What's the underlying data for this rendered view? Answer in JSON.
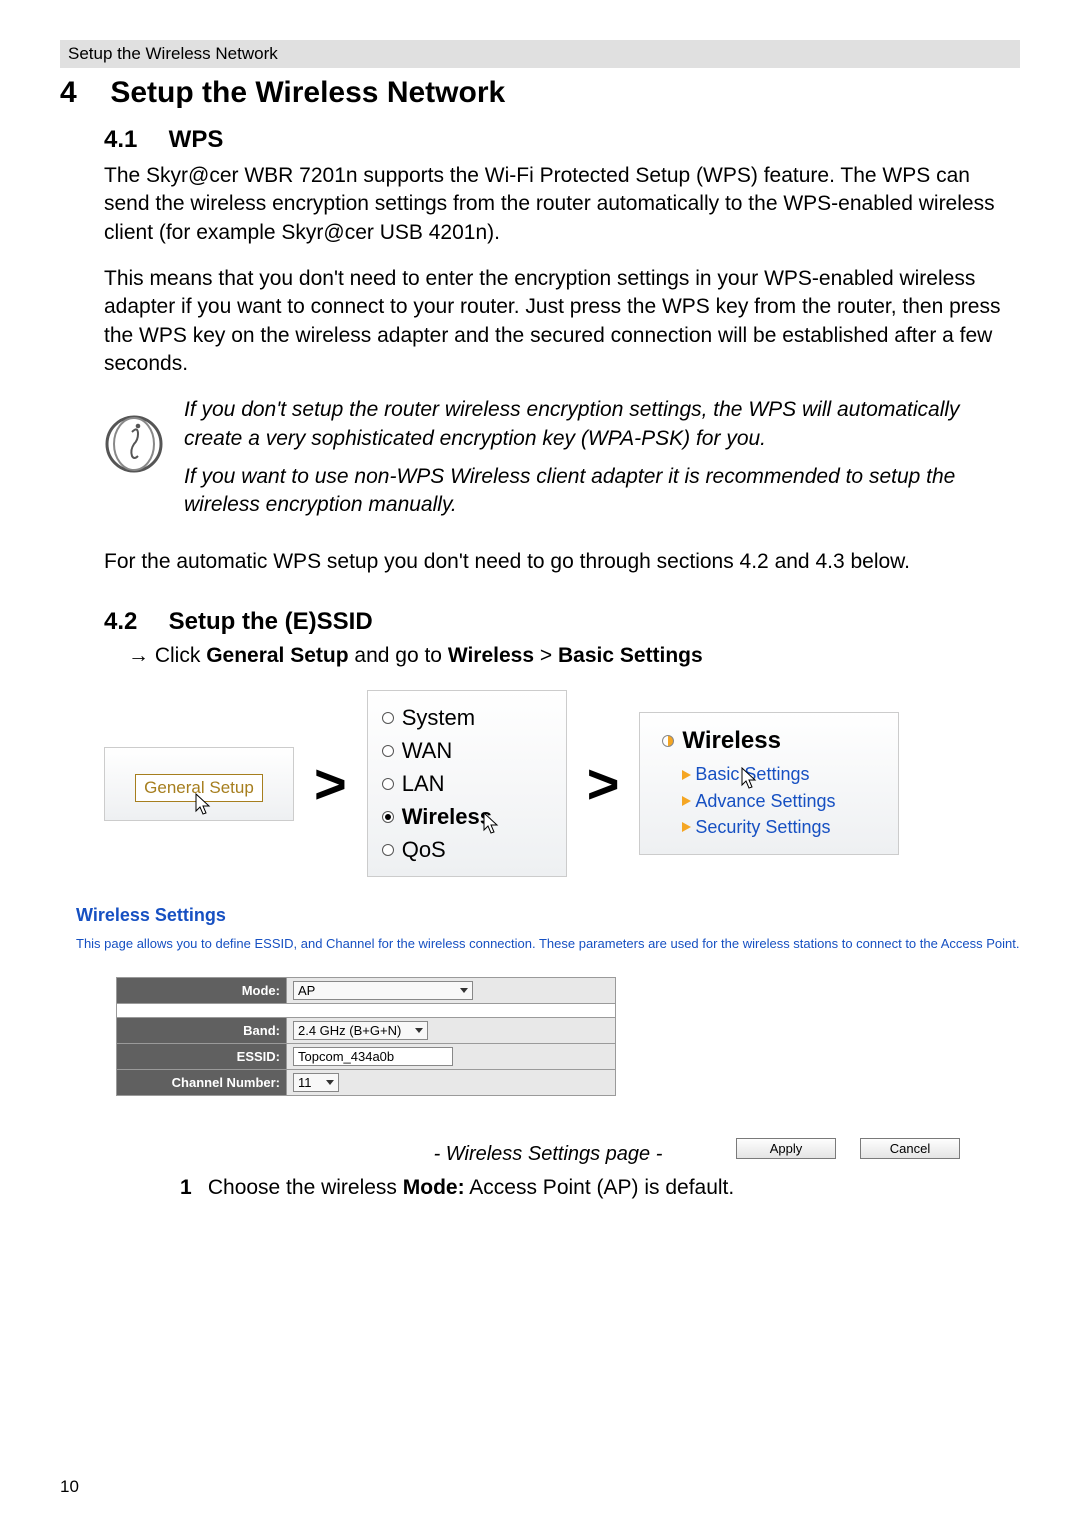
{
  "header": {
    "running_title": "Setup the Wireless Network"
  },
  "section4": {
    "num": "4",
    "title": "Setup the Wireless Network",
    "s41": {
      "num": "4.1",
      "title": "WPS",
      "p1": "The Skyr@cer WBR 7201n supports the Wi-Fi Protected Setup (WPS) feature. The WPS can send the wireless encryption settings from the router automatically to the WPS-enabled wireless client (for example Skyr@cer USB 4201n).",
      "p2": "This means that you don't need to enter the encryption settings in your WPS-enabled wireless adapter if you want to connect to your router. Just press the WPS key from the router, then press the WPS key on the wireless adapter and the secured connection will be established after a few seconds.",
      "note1": "If you don't setup the router wireless encryption settings, the WPS will automatically create a very sophisticated encryption key (WPA-PSK) for you.",
      "note2": "If you want to use non-WPS Wireless client adapter it is recommended to setup the wireless encryption manually.",
      "p3": "For the automatic WPS setup you don't need to go through sections 4.2 and 4.3 below."
    },
    "s42": {
      "num": "4.2",
      "title": "Setup the (E)SSID",
      "instruction_prefix": "Click ",
      "instruction_b1": "General Setup",
      "instruction_mid": " and go to ",
      "instruction_b2": "Wireless",
      "instruction_sep": " > ",
      "instruction_b3": "Basic Settings",
      "nav": {
        "general_setup": "General Setup",
        "menu": {
          "system": "System",
          "wan": "WAN",
          "lan": "LAN",
          "wireless": "Wireless",
          "qos": "QoS"
        },
        "sub": {
          "title": "Wireless",
          "basic": "Basic Settings",
          "advanced": "Advance Settings",
          "security": "Security Settings"
        }
      },
      "wireless_settings": {
        "heading": "Wireless Settings",
        "description": "This page allows you to define ESSID, and Channel for the wireless connection. These parameters are used for the wireless stations to connect to the Access Point.",
        "rows": {
          "mode_label": "Mode:",
          "mode_value": "AP",
          "band_label": "Band:",
          "band_value": "2.4 GHz (B+G+N)",
          "essid_label": "ESSID:",
          "essid_value": "Topcom_434a0b",
          "channel_label": "Channel Number:",
          "channel_value": "11"
        },
        "buttons": {
          "apply": "Apply",
          "cancel": "Cancel"
        },
        "caption": "- Wireless Settings page -"
      },
      "step1": {
        "n": "1",
        "text_a": "Choose the wireless ",
        "text_b": "Mode:",
        "text_c": " Access Point (AP) is default."
      }
    }
  },
  "page_number": "10"
}
